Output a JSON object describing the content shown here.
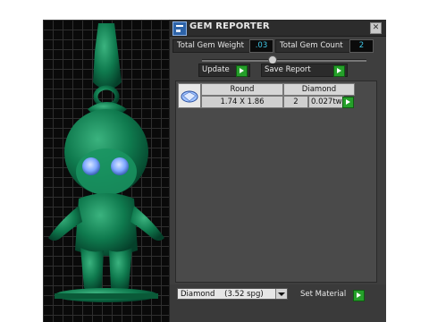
{
  "window": {
    "title": "GEM REPORTER",
    "close_glyph": "✕"
  },
  "stats": {
    "total_weight_label": "Total Gem Weight",
    "total_weight_value": ".03",
    "total_count_label": "Total Gem Count",
    "total_count_value": "2"
  },
  "actions": {
    "update_label": "Update",
    "save_report_label": "Save Report"
  },
  "gem_table": {
    "columns": [
      "Round",
      "Diamond"
    ],
    "rows": [
      {
        "size": "1.74 X 1.86",
        "count": "2",
        "weight": "0.027tw"
      }
    ]
  },
  "material": {
    "selected": "Diamond    (3.52 spg)",
    "set_label": "Set Material"
  },
  "colors": {
    "model_green": "#0f7a4e",
    "gem_blue": "#7ea7ff",
    "value_cyan": "#40c8e8",
    "go_green": "#25a02a"
  }
}
